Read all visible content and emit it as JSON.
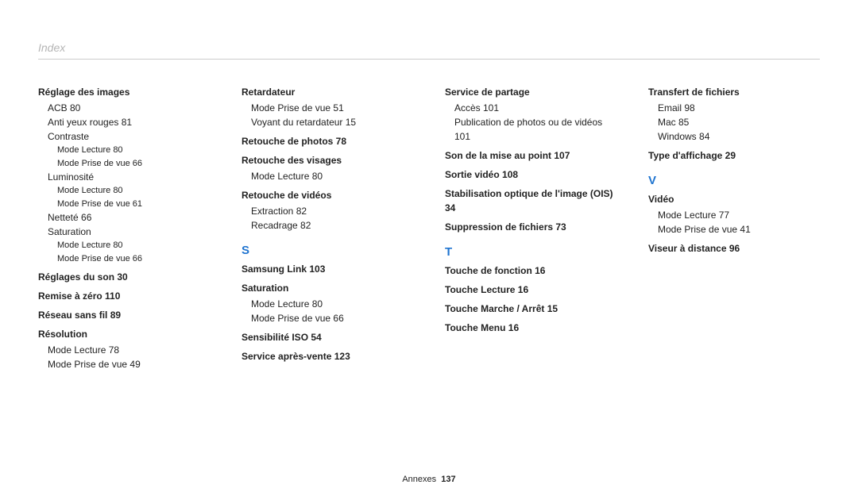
{
  "header": {
    "title": "Index"
  },
  "footer": {
    "section": "Annexes",
    "page": "137"
  },
  "col1": {
    "h1": "Réglage des images",
    "acb": "ACB  80",
    "yeux": "Anti yeux rouges  81",
    "contraste": "Contraste",
    "contraste_lec": "Mode Lecture  80",
    "contraste_prise": "Mode Prise de vue  66",
    "lumin": "Luminosité",
    "lumin_lec": "Mode Lecture  80",
    "lumin_prise": "Mode Prise de vue  61",
    "nett": "Netteté  66",
    "sat": "Saturation",
    "sat_lec": "Mode Lecture  80",
    "sat_prise": "Mode Prise de vue  66",
    "h2": "Réglages du son  30",
    "h3": "Remise à zéro  110",
    "h4": "Réseau sans fil  89",
    "h5": "Résolution",
    "res_lec": "Mode Lecture  78",
    "res_prise": "Mode Prise de vue  49"
  },
  "col2": {
    "h1": "Retardateur",
    "ret_prise": "Mode Prise de vue  51",
    "ret_voy": "Voyant du retardateur  15",
    "h2": "Retouche de photos  78",
    "h3": "Retouche des visages",
    "vis_lec": "Mode Lecture  80",
    "h4": "Retouche de vidéos",
    "vid_ext": "Extraction  82",
    "vid_rec": "Recadrage  82",
    "letter": "S",
    "h5": "Samsung Link  103",
    "h6": "Saturation",
    "sat_lec": "Mode Lecture  80",
    "sat_prise": "Mode Prise de vue  66",
    "h7": "Sensibilité ISO  54",
    "h8": "Service après-vente  123"
  },
  "col3": {
    "h1": "Service de partage",
    "sp_acc": "Accès  101",
    "sp_pub": "Publication de photos ou de vidéos  101",
    "h2": "Son de la mise au point  107",
    "h3": "Sortie vidéo  108",
    "h4": "Stabilisation optique de l'image (OIS)  34",
    "h5": "Suppression de fichiers  73",
    "letter": "T",
    "h6": "Touche de fonction  16",
    "h7": "Touche Lecture  16",
    "h8": "Touche Marche / Arrêt  15",
    "h9": "Touche Menu  16"
  },
  "col4": {
    "h1": "Transfert de fichiers",
    "tf_email": "Email  98",
    "tf_mac": "Mac  85",
    "tf_win": "Windows  84",
    "h2": "Type d'affichage  29",
    "letter": "V",
    "h3": "Vidéo",
    "vid_lec": "Mode Lecture  77",
    "vid_prise": "Mode Prise de vue  41",
    "h4": "Viseur à distance  96"
  }
}
